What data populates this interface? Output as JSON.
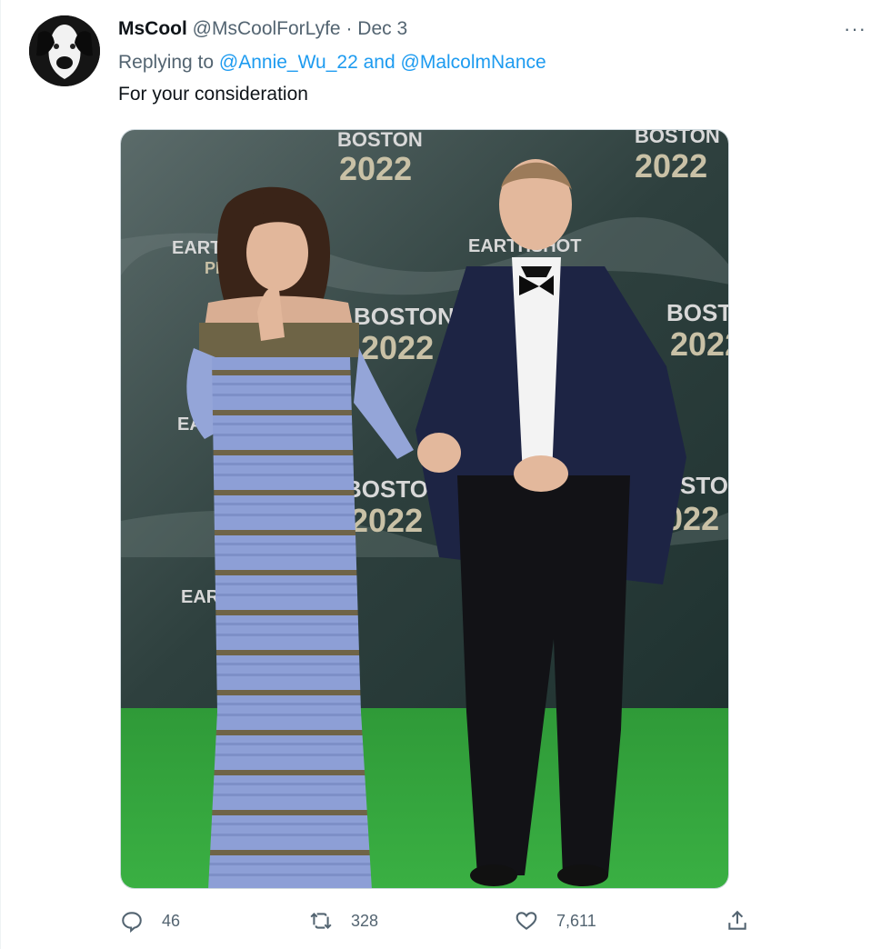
{
  "tweet": {
    "display_name": "MsCool",
    "handle": "@MsCoolForLyfe",
    "separator": "·",
    "date": "Dec 3",
    "replying_prefix": "Replying to",
    "mention_1": "@Annie_Wu_22",
    "mention_joiner": "and",
    "mention_2": "@MalcolmNance",
    "text": "For your consideration",
    "more_label": "···"
  },
  "photo": {
    "backdrop_words": [
      "BOSTON",
      "2022",
      "EARTHSHOT",
      "PRIZE"
    ]
  },
  "actions": {
    "replies": "46",
    "retweets": "328",
    "likes": "7,611"
  },
  "icons": {
    "reply": "speech-bubble-icon",
    "retweet": "retweet-icon",
    "like": "heart-icon",
    "share": "share-upload-icon",
    "more": "more-dots-icon"
  },
  "colors": {
    "accent": "#1d9bf0",
    "secondary_text": "#536471",
    "carpet": "#2f9a38"
  }
}
